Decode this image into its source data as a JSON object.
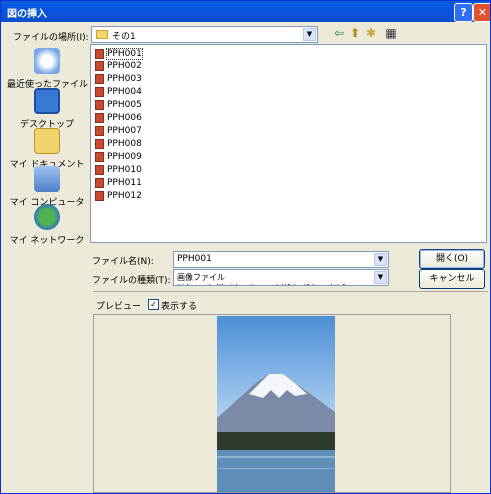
{
  "window": {
    "title": "図の挿入",
    "help_glyph": "?",
    "close_glyph": "✕"
  },
  "lookin": {
    "label": "ファイルの場所(I):",
    "value": "その1"
  },
  "toolbar": {
    "back": "⇦",
    "up": "⬆",
    "new_folder": "✱",
    "views": "▦"
  },
  "places": [
    {
      "label": "最近使ったファイル"
    },
    {
      "label": "デスクトップ"
    },
    {
      "label": "マイ ドキュメント"
    },
    {
      "label": "マイ コンピュータ"
    },
    {
      "label": "マイ ネットワーク"
    }
  ],
  "files": [
    "PPH001",
    "PPH002",
    "PPH003",
    "PPH004",
    "PPH005",
    "PPH006",
    "PPH007",
    "PPH008",
    "PPH009",
    "PPH010",
    "PPH011",
    "PPH012"
  ],
  "filename": {
    "label": "ファイル名(N):",
    "value": "PPH001"
  },
  "filetype": {
    "label": "ファイルの種類(T):",
    "value": "画像ファイル (*.bmp;*.dib;*.jpg;*.png;*.tif;*.gif;*.psd;*.fp"
  },
  "buttons": {
    "open": "開く(O)",
    "cancel": "キャンセル"
  },
  "preview": {
    "label": "プレビュー",
    "checkbox_label": "表示する",
    "checked": "✓"
  }
}
